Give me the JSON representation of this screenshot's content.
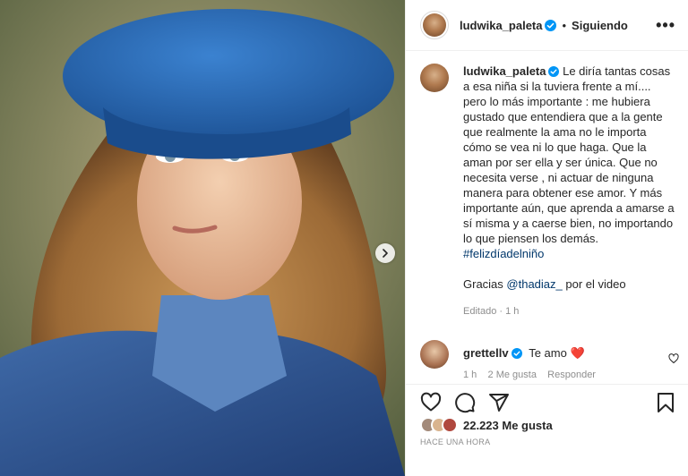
{
  "post": {
    "username": "ludwika_paleta",
    "follow_status": "Siguiendo",
    "dot": "•",
    "more": "•••",
    "image_alt": "Niña con boina azul y chaqueta de mezclilla"
  },
  "caption": {
    "username": "ludwika_paleta",
    "text": "Le diría tantas cosas a esa niña si la tuviera frente a mí.... pero lo más importante : me hubiera gustado que entendiera que a la gente que realmente la ama no le importa cómo se vea ni lo que haga. Que la aman por ser ella y ser única. Que no necesita verse , ni actuar de ninguna manera para obtener ese amor. Y más importante aún, que aprenda a amarse a sí misma y a caerse bien, no importando lo que piensen los demás.",
    "hashtag": "#felizdíadelniño",
    "thanks_prefix": "Gracias ",
    "mention": "@thadiaz_",
    "thanks_suffix": " por el video",
    "edited": "Editado · 1 h"
  },
  "comment": {
    "username": "grettellv",
    "text": "Te amo",
    "emoji": "❤️",
    "meta": "1 h    2 Me gusta    Responder"
  },
  "footer": {
    "likes": "22.223 Me gusta",
    "time": "HACE UNA HORA"
  },
  "colors": {
    "verified": "#0095f6",
    "beret": "#2e6fb8",
    "heart": "#ed4956"
  }
}
